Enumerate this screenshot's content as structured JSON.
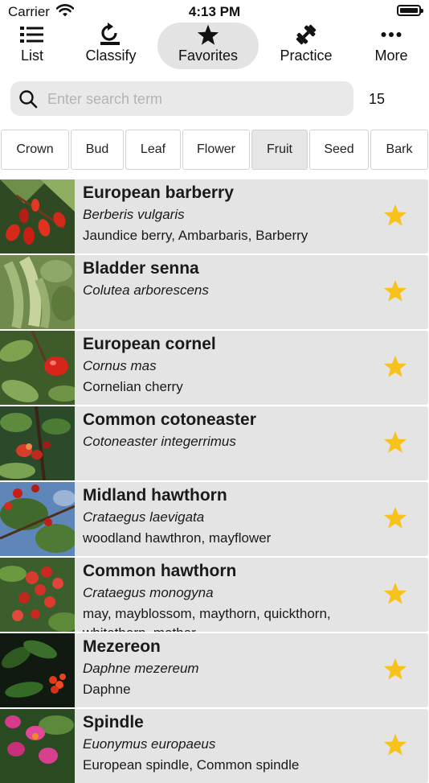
{
  "status_bar": {
    "carrier": "Carrier",
    "time": "4:13 PM"
  },
  "nav": {
    "items": [
      {
        "label": "List",
        "icon": "list-icon"
      },
      {
        "label": "Classify",
        "icon": "classify-icon"
      },
      {
        "label": "Favorites",
        "icon": "star-icon",
        "active": true
      },
      {
        "label": "Practice",
        "icon": "dumbbell-icon"
      },
      {
        "label": "More",
        "icon": "ellipsis-icon"
      }
    ]
  },
  "search": {
    "placeholder": "Enter search term",
    "value": "",
    "count": "15"
  },
  "filters": {
    "tabs": [
      {
        "label": "Crown"
      },
      {
        "label": "Bud"
      },
      {
        "label": "Leaf"
      },
      {
        "label": "Flower"
      },
      {
        "label": "Fruit",
        "active": true
      },
      {
        "label": "Seed"
      },
      {
        "label": "Bark"
      }
    ]
  },
  "colors": {
    "star": "#f8c21c",
    "card": "#e4e4e4",
    "active_tab": "#e6e6e6"
  },
  "plants": [
    {
      "name": "European barberry",
      "latin": "Berberis vulgaris",
      "common": "Jaundice berry, Ambarbaris, Barberry",
      "favorite": true
    },
    {
      "name": "Bladder senna",
      "latin": "Colutea arborescens",
      "common": "",
      "favorite": true
    },
    {
      "name": "European cornel",
      "latin": "Cornus mas",
      "common": "Cornelian cherry",
      "favorite": true
    },
    {
      "name": "Common cotoneaster",
      "latin": "Cotoneaster integerrimus",
      "common": "",
      "favorite": true
    },
    {
      "name": "Midland hawthorn",
      "latin": "Crataegus laevigata",
      "common": "woodland hawthron, mayflower",
      "favorite": true
    },
    {
      "name": "Common hawthorn",
      "latin": "Crataegus monogyna",
      "common": "may, mayblossom, maythorn, quickthorn, whitethorn, mother...",
      "favorite": true
    },
    {
      "name": "Mezereon",
      "latin": "Daphne mezereum",
      "common": "Daphne",
      "favorite": true
    },
    {
      "name": "Spindle",
      "latin": "Euonymus europaeus",
      "common": "European spindle, Common spindle",
      "favorite": true
    }
  ]
}
